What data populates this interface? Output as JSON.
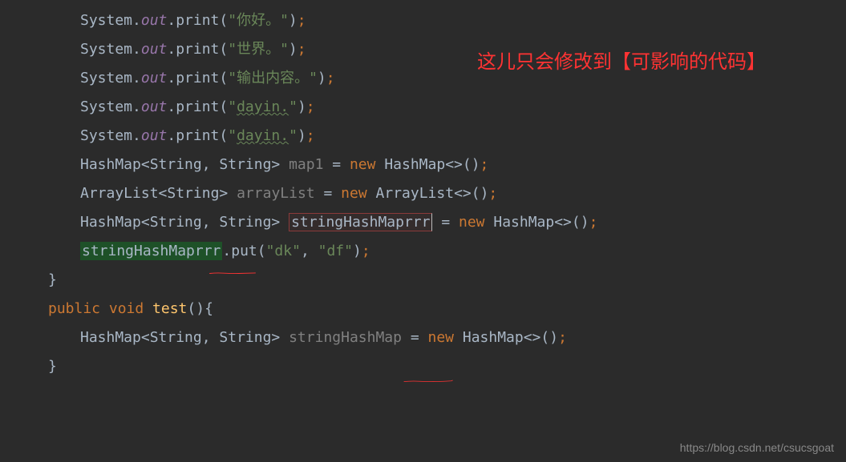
{
  "annotation": "这儿只会修改到【可影响的代码】",
  "watermark": "https://blog.csdn.net/csucsgoat",
  "code": {
    "l1": {
      "sys": "System.",
      "out": "out",
      "print": ".print(",
      "str": "\"你好。\"",
      "end": ")",
      "semi": ";"
    },
    "l2": {
      "sys": "System.",
      "out": "out",
      "print": ".print(",
      "str": "\"世界。\"",
      "end": ")",
      "semi": ";"
    },
    "l3": {
      "sys": "System.",
      "out": "out",
      "print": ".print(",
      "str": "\"输出内容。\"",
      "end": ")",
      "semi": ";"
    },
    "l4": {
      "sys": "System.",
      "out": "out",
      "print": ".print(",
      "str": "\"",
      "warn": "dayin.",
      "strEnd": "\"",
      "end": ")",
      "semi": ";"
    },
    "l5": {
      "sys": "System.",
      "out": "out",
      "print": ".print(",
      "str": "\"",
      "warn": "dayin.",
      "strEnd": "\"",
      "end": ")",
      "semi": ";"
    },
    "l6": {
      "type": "HashMap",
      "generic": "<String, String> ",
      "var": "map1",
      "eq": " = ",
      "new": "new ",
      "ctor": "HashMap",
      "diamond": "<>()",
      "semi": ";"
    },
    "l7": {
      "type": "ArrayList",
      "generic": "<String> ",
      "var": "arrayList",
      "eq": " = ",
      "new": "new ",
      "ctor": "ArrayList",
      "diamond": "<>()",
      "semi": ";"
    },
    "l8": {
      "type": "HashMap",
      "generic": "<String, String> ",
      "var": "stringHashMaprrr",
      "eq": " = ",
      "new": "new ",
      "ctor": "HashMap",
      "diamond": "<>()",
      "semi": ";"
    },
    "l9": {
      "var": "stringHashMaprrr",
      "method": ".put(",
      "s1": "\"dk\"",
      "comma": ", ",
      "s2": "\"df\"",
      "end": ")",
      "semi": ";"
    },
    "l10": {
      "brace": "}"
    },
    "l11": {
      "empty": ""
    },
    "l12": {
      "public": "public ",
      "void": "void ",
      "method": "test",
      "paren": "(){"
    },
    "l13": {
      "type": "HashMap",
      "generic": "<String, String> ",
      "var": "stringHashMap",
      "eq": " = ",
      "new": "new ",
      "ctor": "HashMap",
      "diamond": "<>()",
      "semi": ";"
    },
    "l14": {
      "brace": "}"
    }
  }
}
